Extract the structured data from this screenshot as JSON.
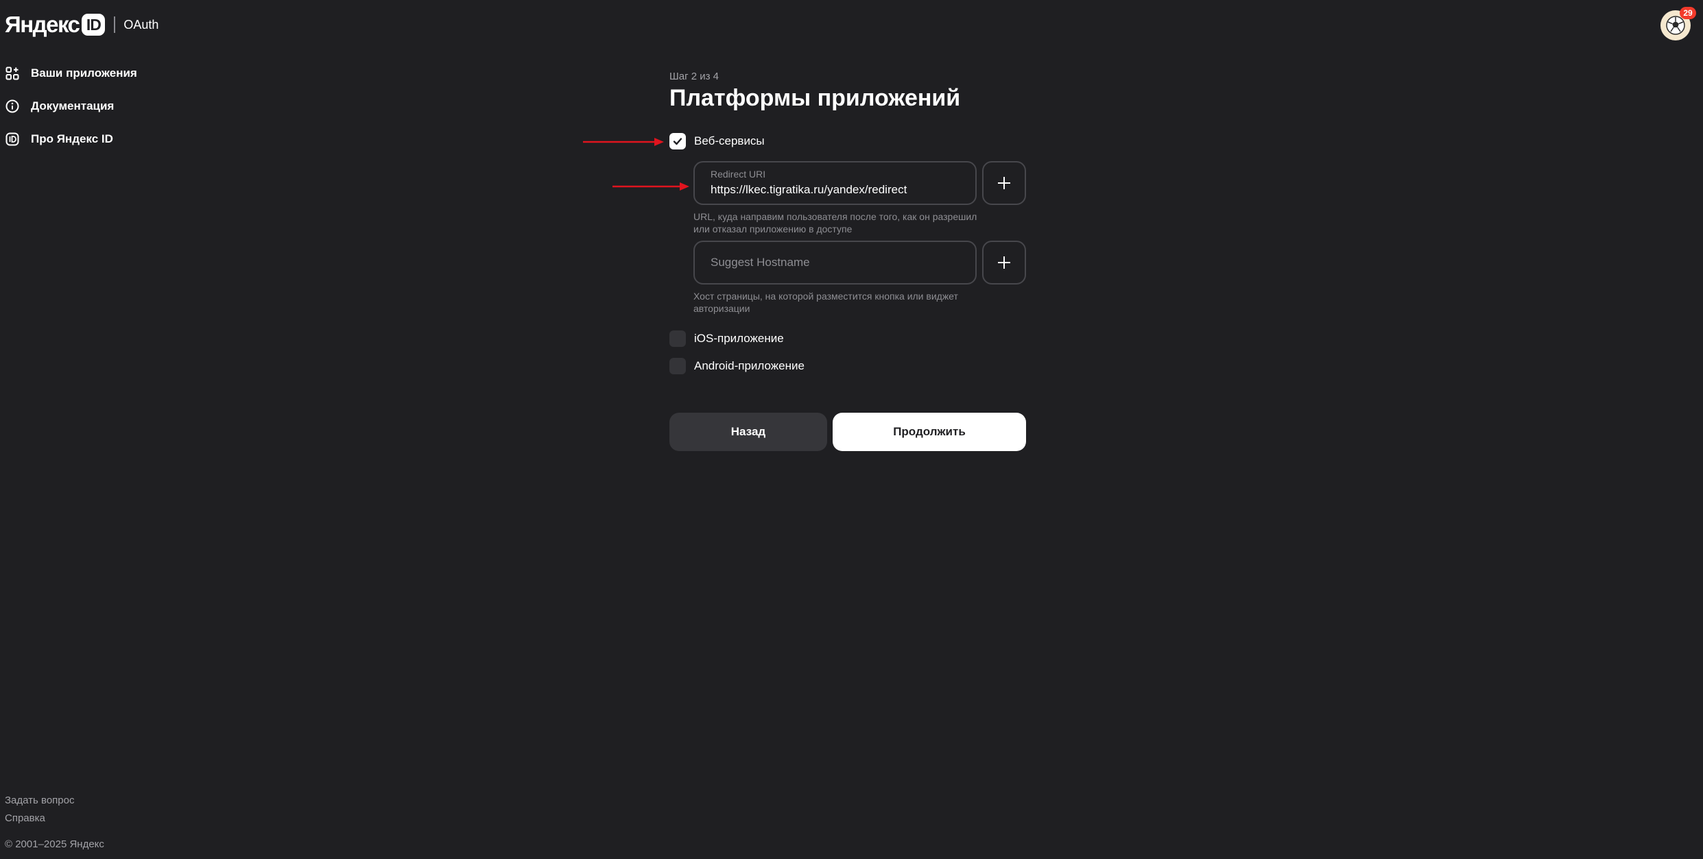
{
  "header": {
    "logo_text": "Яндекс",
    "logo_id": "ID",
    "service": "OAuth",
    "notification_count": "29"
  },
  "sidebar": {
    "items": [
      {
        "label": "Ваши приложения",
        "icon": "apps-grid-icon"
      },
      {
        "label": "Документация",
        "icon": "info-icon"
      },
      {
        "label": "Про Яндекс ID",
        "icon": "id-icon"
      }
    ]
  },
  "footer": {
    "links": [
      "Задать вопрос",
      "Справка"
    ],
    "copyright": "© 2001–2025 Яндекс"
  },
  "main": {
    "step": "Шаг 2 из 4",
    "title": "Платформы приложений",
    "platforms": [
      {
        "label": "Веб-сервисы",
        "checked": true
      },
      {
        "label": "iOS-приложение",
        "checked": false
      },
      {
        "label": "Android-приложение",
        "checked": false
      }
    ],
    "redirect": {
      "label": "Redirect URI",
      "value": "https://lkec.tigratika.ru/yandex/redirect",
      "hint": "URL, куда направим пользователя после того, как он разрешил или отказал приложению в доступе"
    },
    "hostname": {
      "placeholder": "Suggest Hostname",
      "hint": "Хост страницы, на которой разместится кнопка или виджет авторизации"
    },
    "back_label": "Назад",
    "continue_label": "Продолжить"
  },
  "colors": {
    "background": "#1f1f22",
    "annotation_arrow": "#e0141e",
    "badge": "#f33a2b"
  }
}
